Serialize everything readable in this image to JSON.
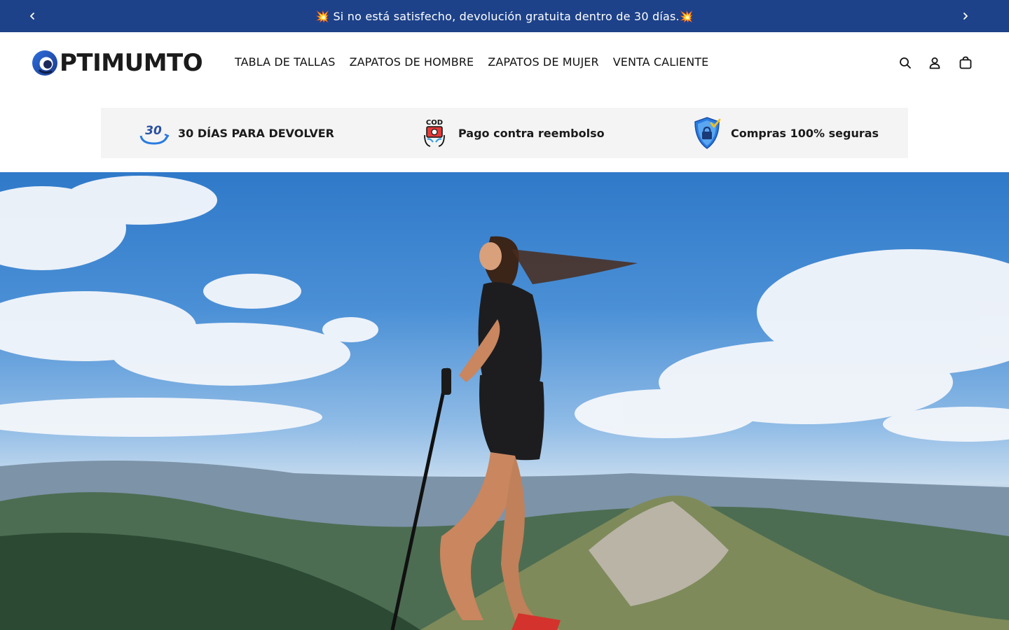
{
  "announcement": {
    "message": "💥 Si no está satisfecho, devolución gratuita dentro de 30 días.💥"
  },
  "brand": {
    "name": "PTIMUMTO",
    "primary_color": "#1d4289"
  },
  "nav": {
    "items": [
      {
        "label": "TABLA DE TALLAS"
      },
      {
        "label": "ZAPATOS DE HOMBRE"
      },
      {
        "label": "ZAPATOS DE MUJER"
      },
      {
        "label": "VENTA CALIENTE"
      }
    ]
  },
  "header_icons": {
    "search": "search-icon",
    "account": "account-icon",
    "cart": "cart-icon"
  },
  "trust": {
    "items": [
      {
        "icon": "30-days-return-icon",
        "icon_text": "30",
        "label": "30 DÍAS PARA DEVOLVER"
      },
      {
        "icon": "cash-on-delivery-icon",
        "icon_text": "COD",
        "label": "Pago contra reembolso"
      },
      {
        "icon": "secure-shield-icon",
        "label": "Compras 100% seguras"
      }
    ]
  },
  "hero": {
    "image": "hiker-woman-mountain-summit-photo"
  }
}
